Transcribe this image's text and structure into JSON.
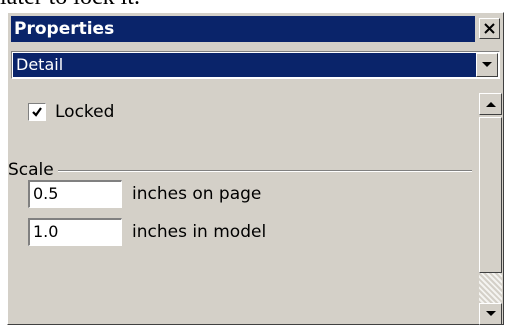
{
  "background_text": "later to lock it.",
  "window": {
    "title": "Properties",
    "close_icon": "close-x-icon"
  },
  "dropdown": {
    "selected": "Detail",
    "arrow_icon": "chevron-down-icon"
  },
  "locked": {
    "label": "Locked",
    "checked": true
  },
  "scale": {
    "group_label": "Scale",
    "page_value": "0.5",
    "page_label": "inches on page",
    "model_value": "1.0",
    "model_label": "inches in model"
  },
  "colors": {
    "title_bar": "#0a246a",
    "panel": "#d4d0c8"
  }
}
